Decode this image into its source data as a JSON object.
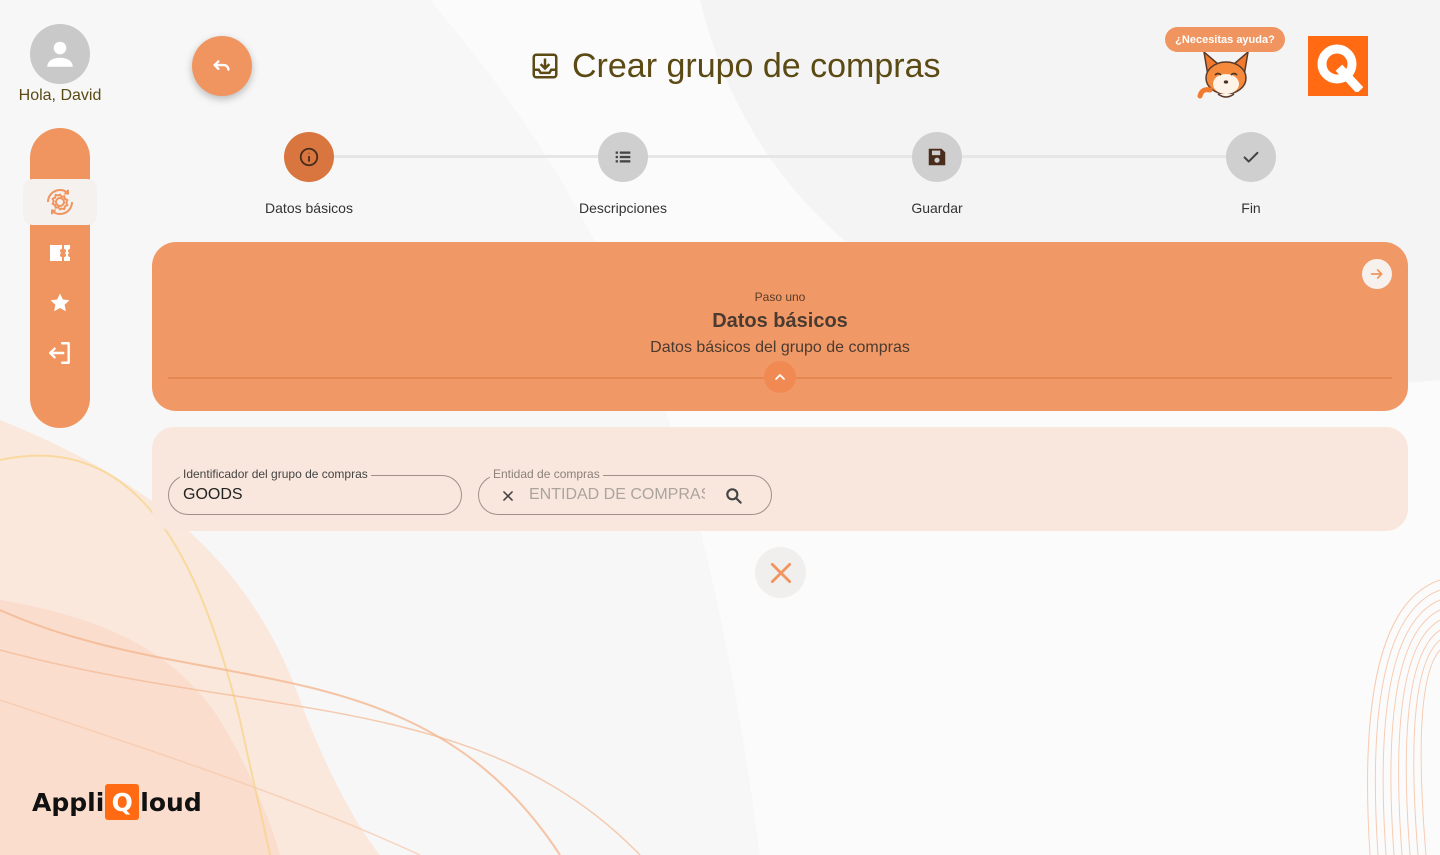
{
  "user": {
    "greeting": "Hola, David"
  },
  "header": {
    "title": "Crear grupo de compras",
    "help_label": "¿Necesitas ayuda?",
    "logo_letter": "Q"
  },
  "sidebar": {
    "items": [
      {
        "name": "settings-cycle-icon",
        "active": true
      },
      {
        "name": "ticket-icon",
        "active": false
      },
      {
        "name": "star-icon",
        "active": false
      },
      {
        "name": "logout-icon",
        "active": false
      }
    ]
  },
  "stepper": {
    "steps": [
      {
        "label": "Datos básicos",
        "icon": "info-icon",
        "active": true
      },
      {
        "label": "Descripciones",
        "icon": "list-icon",
        "active": false
      },
      {
        "label": "Guardar",
        "icon": "save-icon",
        "active": false
      },
      {
        "label": "Fin",
        "icon": "check-icon",
        "active": false
      }
    ]
  },
  "step_card": {
    "kicker": "Paso uno",
    "heading": "Datos básicos",
    "subheading": "Datos básicos del grupo de compras"
  },
  "form": {
    "group_id": {
      "label": "Identificador del grupo de compras",
      "value": "GOODS"
    },
    "entity": {
      "label": "Entidad de compras",
      "placeholder": "ENTIDAD DE COMPRAS",
      "value": ""
    }
  },
  "brand": {
    "prefix": "Appli",
    "q": "Q",
    "suffix": "loud"
  },
  "colors": {
    "accent": "#f0955f",
    "accent_dark": "#d9763f",
    "brand_orange": "#ff6a13",
    "title": "#5b4a14"
  }
}
